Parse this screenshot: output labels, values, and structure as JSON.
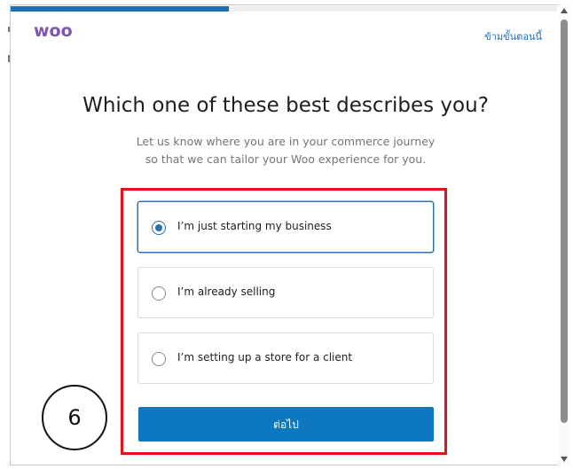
{
  "progress": {
    "percent": 40
  },
  "header": {
    "logo_text": "woo",
    "skip_label": "ข้ามขั้นตอนนี้"
  },
  "main": {
    "title": "Which one of these best describes you?",
    "subtitle_line1": "Let us know where you are in your commerce journey",
    "subtitle_line2": "so that we can tailor your Woo experience for you."
  },
  "options": [
    {
      "label": "I’m just starting my business",
      "selected": true
    },
    {
      "label": "I’m already selling",
      "selected": false
    },
    {
      "label": "I’m setting up a store for a client",
      "selected": false
    }
  ],
  "continue_label": "ต่อไป",
  "annotation": {
    "step_number": "6"
  },
  "colors": {
    "accent": "#0d78c0",
    "logo": "#7f54b3",
    "highlight": "#e8111b",
    "progress": "#1e6fb6"
  }
}
